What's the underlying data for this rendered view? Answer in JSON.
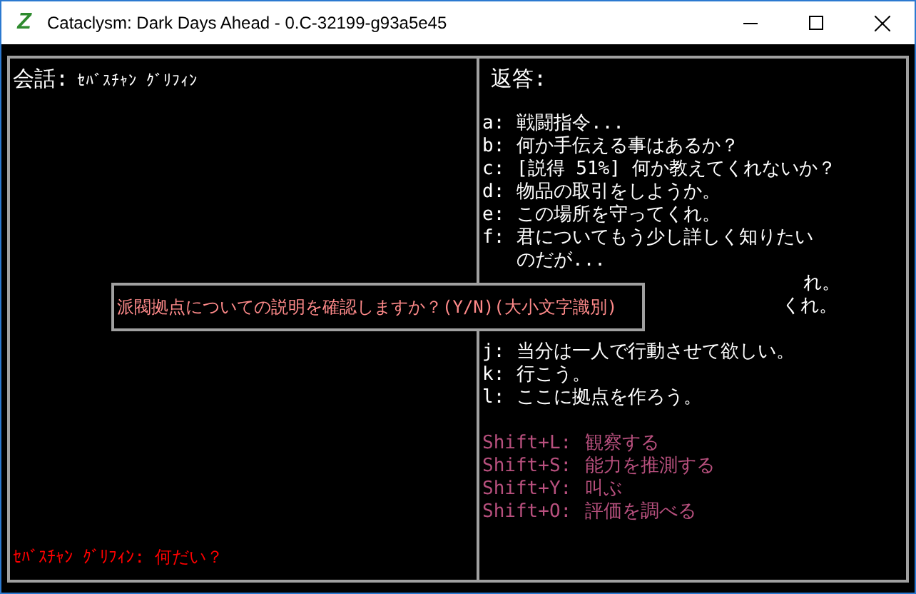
{
  "window": {
    "logo": "Z",
    "title": "Cataclysm: Dark Days Ahead - 0.C-32199-g93a5e45"
  },
  "conversation": {
    "label": "会話:",
    "speaker": "ｾﾊﾞｽﾁｬﾝ ｸﾞﾘﾌｨﾝ",
    "npc_line": "ｾﾊﾞｽﾁｬﾝ ｸﾞﾘﾌｨﾝ: 何だい？"
  },
  "responses": {
    "heading": "返答:",
    "options": [
      {
        "kind": "option",
        "key": "a:",
        "lines": [
          "戦闘指令..."
        ]
      },
      {
        "kind": "option",
        "key": "b:",
        "lines": [
          "何か手伝える事はあるか？"
        ]
      },
      {
        "kind": "option",
        "key": "c:",
        "lines": [
          "[説得 51%] 何か教えてくれないか？"
        ]
      },
      {
        "kind": "option",
        "key": "d:",
        "lines": [
          "物品の取引をしようか。"
        ]
      },
      {
        "kind": "option",
        "key": "e:",
        "lines": [
          "この場所を守ってくれ。"
        ]
      },
      {
        "kind": "option",
        "key": "f:",
        "lines": [
          "君についてもう少し詳しく知りたい",
          "のだが..."
        ]
      },
      {
        "kind": "partial",
        "lines": [
          "れ。"
        ]
      },
      {
        "kind": "partial",
        "lines": [
          "くれ。"
        ]
      },
      {
        "kind": "hidden"
      },
      {
        "kind": "option",
        "key": "j:",
        "lines": [
          "当分は一人で行動させて欲しい。"
        ]
      },
      {
        "kind": "option",
        "key": "k:",
        "lines": [
          "行こう。"
        ]
      },
      {
        "kind": "option",
        "key": "l:",
        "lines": [
          "ここに拠点を作ろう。"
        ]
      }
    ],
    "actions": [
      {
        "key": "Shift+L:",
        "text": "観察する"
      },
      {
        "key": "Shift+S:",
        "text": "能力を推測する"
      },
      {
        "key": "Shift+Y:",
        "text": "叫ぶ"
      },
      {
        "key": "Shift+O:",
        "text": "評価を調べる"
      }
    ]
  },
  "prompt": {
    "text": "派閥拠点についての説明を確認しますか？(Y/N)(大小文字識別)"
  }
}
